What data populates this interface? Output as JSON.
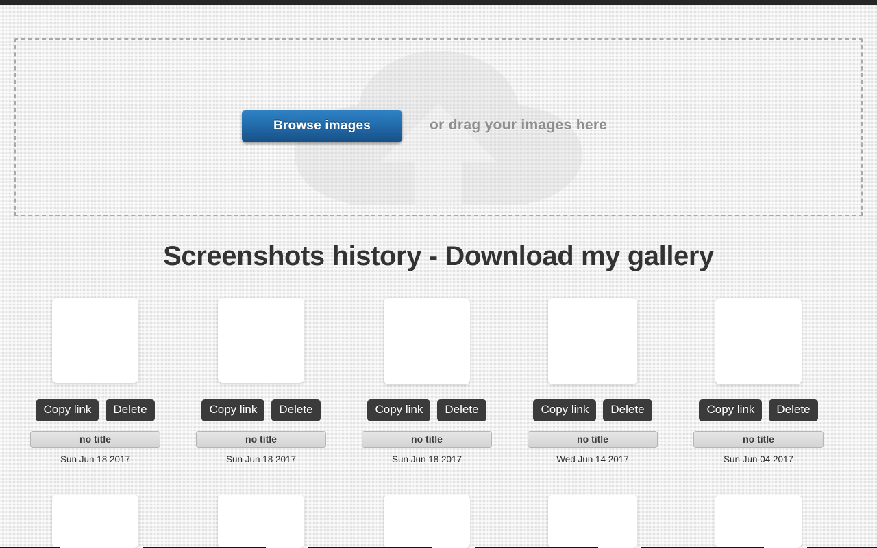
{
  "dropzone": {
    "browse_label": "Browse images",
    "drag_text": "or drag your images here",
    "watermark_icon": "cloud-upload-icon"
  },
  "gallery": {
    "heading": "Screenshots history - Download my gallery",
    "copy_label": "Copy link",
    "delete_label": "Delete",
    "title_placeholder": "no title",
    "items": [
      {
        "title": "no title",
        "date": "Sun Jun 18 2017",
        "thumb_w": 126,
        "thumb_h": 124
      },
      {
        "title": "no title",
        "date": "Sun Jun 18 2017",
        "thumb_w": 126,
        "thumb_h": 124
      },
      {
        "title": "no title",
        "date": "Sun Jun 18 2017",
        "thumb_w": 126,
        "thumb_h": 126
      },
      {
        "title": "no title",
        "date": "Wed Jun 14 2017",
        "thumb_w": 130,
        "thumb_h": 126
      },
      {
        "title": "no title",
        "date": "Sun Jun 04 2017",
        "thumb_w": 126,
        "thumb_h": 126
      }
    ],
    "items_row2": [
      {
        "thumb_w": 126,
        "thumb_h": 78
      },
      {
        "thumb_w": 126,
        "thumb_h": 78
      },
      {
        "thumb_w": 126,
        "thumb_h": 78
      },
      {
        "thumb_w": 130,
        "thumb_h": 78
      },
      {
        "thumb_w": 126,
        "thumb_h": 78
      }
    ]
  },
  "colors": {
    "page_background": "#e9e9e9",
    "top_bar": "#262626",
    "browse_button_top": "#3282c2",
    "browse_button_bottom": "#184f84",
    "action_button": "#3b3b3b",
    "heading_text": "#333333",
    "drag_text": "#8e8e8e",
    "dropzone_border": "#a9a9a9"
  }
}
